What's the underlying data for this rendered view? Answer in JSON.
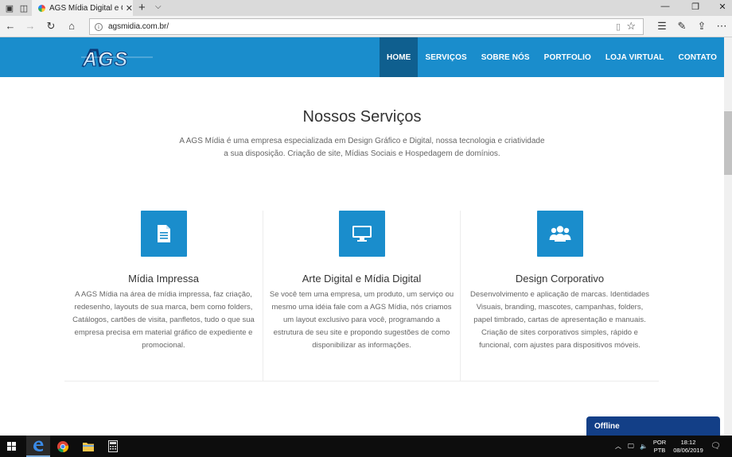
{
  "browser": {
    "tab_title": "AGS Mídia Digital e Grá",
    "url": "agsmidia.com.br/"
  },
  "site": {
    "logo_text": "AGS",
    "menu": [
      {
        "label": "HOME",
        "active": true
      },
      {
        "label": "SERVIÇOS"
      },
      {
        "label": "SOBRE NÓS"
      },
      {
        "label": "PORTFOLIO"
      },
      {
        "label": "LOJA VIRTUAL"
      },
      {
        "label": "CONTATO"
      }
    ]
  },
  "content": {
    "title": "Nossos Serviços",
    "description": "A AGS Mídia é uma empresa especializada em Design Gráfico e Digital, nossa tecnologia e criatividade a sua disposição. Criação de site, Mídias Sociais e Hospedagem de domínios.",
    "services": [
      {
        "icon": "document-icon",
        "title": "Mídia Impressa",
        "text": "A AGS Mídia na área de mídia impressa, faz criação, redesenho, layouts de sua marca, bem como folders, Catálogos, cartões de visita, panfletos, tudo o que sua empresa precisa em material gráfico de expediente e promocional."
      },
      {
        "icon": "monitor-icon",
        "title": "Arte Digital e Mídia Digital",
        "text": "Se você tem uma empresa, um produto, um serviço ou mesmo uma idéia fale com a AGS Mídia, nós criamos um layout exclusivo para você, programando a estrutura de seu site e propondo sugestões de como disponibilizar as informações."
      },
      {
        "icon": "users-icon",
        "title": "Design Corporativo",
        "text": "Desenvolvimento e aplicação de marcas. Identidades Visuais, branding, mascotes, campanhas, folders, papel timbrado, cartas de apresentação e manuais. Criação de sites corporativos simples, rápido e funcional, com ajustes para dispositivos móveis."
      }
    ]
  },
  "chat": {
    "label": "Offline"
  },
  "taskbar": {
    "lang_line1": "POR",
    "lang_line2": "PTB",
    "time": "18:12",
    "date": "08/06/2019"
  },
  "colors": {
    "brand_blue": "#1a8dcc",
    "active_menu": "#0f5f8f",
    "chat_blue": "#133f87"
  }
}
